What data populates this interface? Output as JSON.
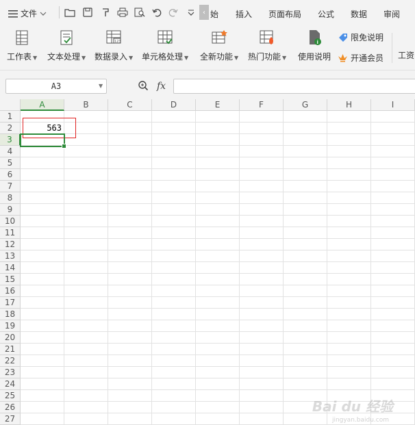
{
  "menu": {
    "file_label": "文件"
  },
  "tabs": [
    {
      "label": "始"
    },
    {
      "label": "插入"
    },
    {
      "label": "页面布局"
    },
    {
      "label": "公式"
    },
    {
      "label": "数据"
    },
    {
      "label": "审阅"
    }
  ],
  "ribbon": {
    "buttons": [
      {
        "label": "工作表"
      },
      {
        "label": "文本处理"
      },
      {
        "label": "数据录入"
      },
      {
        "label": "单元格处理"
      },
      {
        "label": "全新功能"
      },
      {
        "label": "热门功能"
      },
      {
        "label": "使用说明"
      }
    ],
    "side": {
      "limit_label": "限免说明",
      "vip_label": "开通会员"
    },
    "overflow_label": "工资"
  },
  "formula_bar": {
    "name_box": "A3",
    "fx_label": "fx",
    "formula": ""
  },
  "sheet": {
    "columns": [
      "A",
      "B",
      "C",
      "D",
      "E",
      "F",
      "G",
      "H",
      "I"
    ],
    "rows": [
      "1",
      "2",
      "3",
      "4",
      "5",
      "6",
      "7",
      "8",
      "9",
      "10",
      "11",
      "12",
      "13",
      "14",
      "15",
      "16",
      "17",
      "18",
      "19",
      "20",
      "21",
      "22",
      "23",
      "24",
      "25",
      "26",
      "27"
    ],
    "selected_column": "A",
    "selected_row": "3",
    "cells": {
      "A2": "563"
    }
  },
  "watermark": {
    "main": "Bai du 经验",
    "sub": "jingyan.baidu.com"
  },
  "colors": {
    "accent": "#2e8b3a",
    "highlight": "#e02020"
  }
}
